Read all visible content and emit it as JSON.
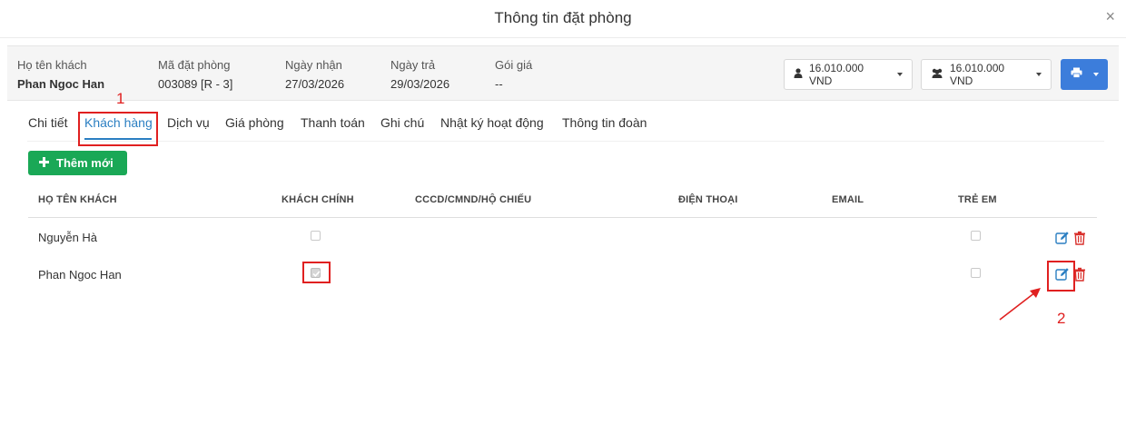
{
  "modal": {
    "title": "Thông tin đặt phòng",
    "close_glyph": "×"
  },
  "info": {
    "guest_label": "Họ tên khách",
    "guest_value": "Phan Ngoc Han",
    "code_label": "Mã đặt phòng",
    "code_value": "003089 [R - 3]",
    "checkin_label": "Ngày nhận",
    "checkin_value": "27/03/2026",
    "checkout_label": "Ngày trả",
    "checkout_value": "29/03/2026",
    "package_label": "Gói giá",
    "package_value": "--"
  },
  "price_buttons": {
    "room_amount": "16.010.000 VND",
    "group_amount": "16.010.000 VND"
  },
  "tabs": [
    "Chi tiết",
    "Khách hàng",
    "Dịch vụ",
    "Giá phòng",
    "Thanh toán",
    "Ghi chú",
    "Nhật ký hoạt động",
    "Thông tin đoàn"
  ],
  "active_tab": "Khách hàng",
  "add_button": {
    "label": "Thêm mới"
  },
  "table": {
    "headers": {
      "name": "HỌ TÊN KHÁCH",
      "primary": "KHÁCH CHÍNH",
      "id": "CCCD/CMND/HỘ CHIẾU",
      "phone": "ĐIỆN THOẠI",
      "email": "EMAIL",
      "child": "TRẺ EM"
    },
    "rows": [
      {
        "name": "Nguyễn Hà",
        "primary": false,
        "id": "",
        "phone": "",
        "email": "",
        "child": false
      },
      {
        "name": "Phan Ngoc Han",
        "primary": true,
        "id": "",
        "phone": "",
        "email": "",
        "child": false
      }
    ]
  },
  "annotations": {
    "step1": "1",
    "step2": "2"
  },
  "colors": {
    "accent": "#2b7fc2",
    "primary_button": "#3c7ddb",
    "success": "#1aa856",
    "danger": "#d9302c",
    "annotation": "#e02020"
  },
  "icons": [
    "close-icon",
    "user-icon",
    "users-icon",
    "print-icon",
    "plus-icon",
    "edit-icon",
    "trash-icon",
    "caret-down-icon",
    "check-icon"
  ]
}
